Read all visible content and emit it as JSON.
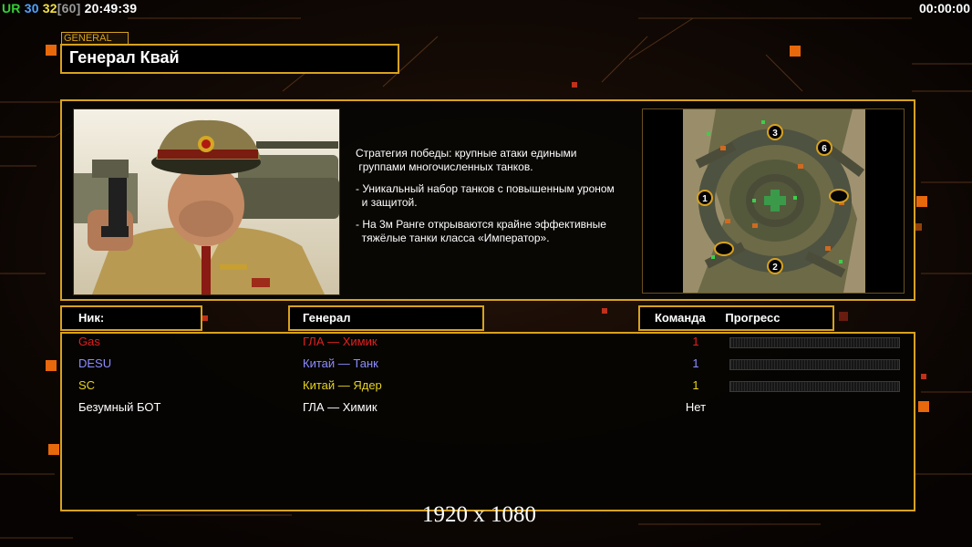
{
  "hud": {
    "ur_label": "UR",
    "fps_a": "30",
    "fps_b": "32",
    "fps_bracket": "[60]",
    "clock": "20:49:39",
    "timer": "00:00:00"
  },
  "general_tag": "GENERAL",
  "general_name": "Генерал Квай",
  "strategy": [
    "Стратегия победы: крупные атаки едиными\n группами многочисленных танков.",
    "- Уникальный набор танков с повышенным уроном\n  и защитой.",
    "- На 3м Ранге открываются крайне эффективные\n  тяжёлые танки класса «Император»."
  ],
  "map_markers": [
    "1",
    "2",
    "3",
    "6"
  ],
  "columns": {
    "nick": "Ник:",
    "general": "Генерал",
    "team": "Команда",
    "progress": "Прогресс"
  },
  "players": [
    {
      "nick": "Gas",
      "general": "ГЛА — Химик",
      "team": "1",
      "color": "#e02020",
      "progress": 0
    },
    {
      "nick": "DESU",
      "general": "Китай — Танк",
      "team": "1",
      "color": "#8c8cff",
      "progress": 0
    },
    {
      "nick": "SC",
      "general": "Китай — Ядер",
      "team": "1",
      "color": "#e6d21e",
      "progress": 0
    },
    {
      "nick": "Безумный БОТ",
      "general": "ГЛА — Химик",
      "team": "Нет",
      "color": "#ffffff",
      "progress": null
    }
  ],
  "resolution": "1920 x 1080",
  "colors": {
    "frame": "#d8a21e",
    "ur": "#34d034",
    "fps_a": "#4ea4ff",
    "fps_b": "#f0e040",
    "fps_bracket": "#9a9a9a"
  }
}
